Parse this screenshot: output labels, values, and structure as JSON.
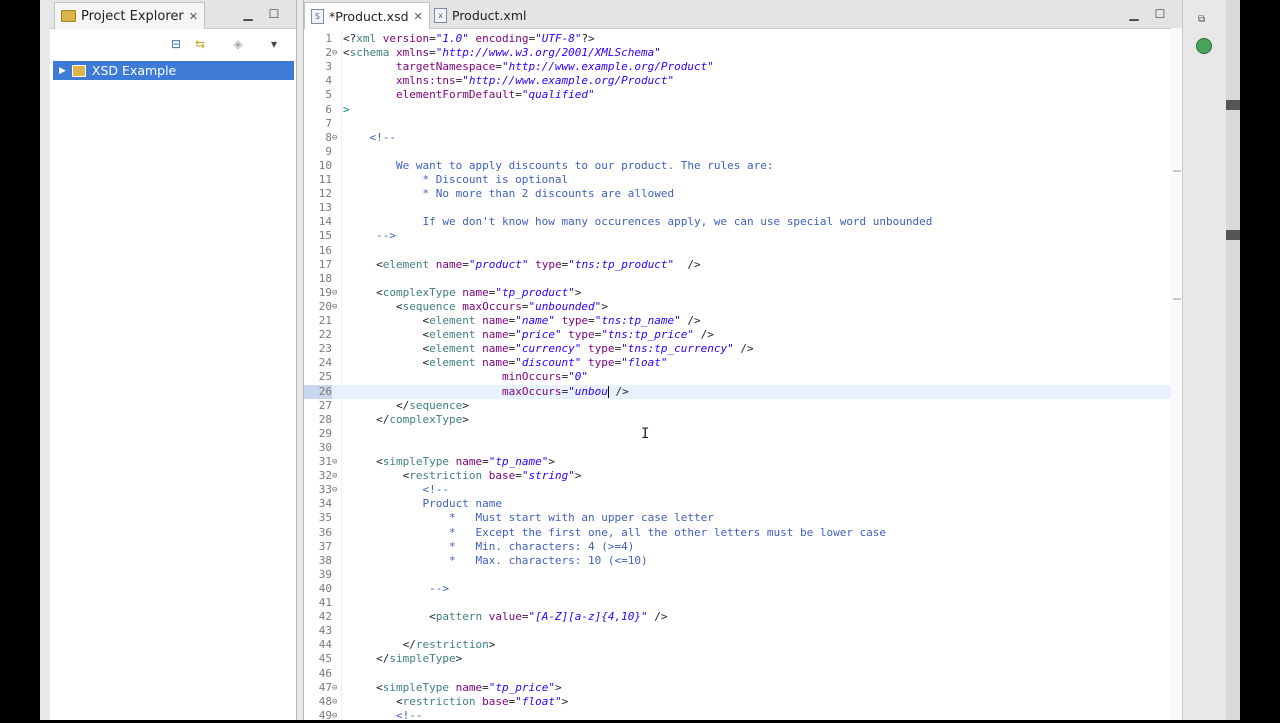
{
  "project_explorer": {
    "title": "Project Explorer",
    "tree": [
      {
        "label": "XSD Example",
        "expanded": false,
        "selected": true
      }
    ]
  },
  "editor": {
    "tabs": [
      {
        "label": "*Product.xsd",
        "active": true,
        "icon": "S"
      },
      {
        "label": "Product.xml",
        "active": false,
        "icon": "x"
      }
    ],
    "current_line": 26,
    "lines": [
      {
        "n": "1",
        "parts": [
          [
            "p",
            "<?"
          ],
          [
            "t",
            "xml "
          ],
          [
            "a",
            "version"
          ],
          [
            "p",
            "="
          ],
          [
            "v",
            "\"1.0\""
          ],
          [
            "a",
            " encoding"
          ],
          [
            "p",
            "="
          ],
          [
            "v",
            "\"UTF-8\""
          ],
          [
            "p",
            "?>"
          ]
        ]
      },
      {
        "n": "2",
        "fold": true,
        "parts": [
          [
            "p",
            "<"
          ],
          [
            "t",
            "schema "
          ],
          [
            "a",
            "xmlns"
          ],
          [
            "p",
            "="
          ],
          [
            "v",
            "\"http://www.w3.org/2001/XMLSchema\""
          ]
        ]
      },
      {
        "n": "3",
        "parts": [
          [
            "p",
            "        "
          ],
          [
            "a",
            "targetNamespace"
          ],
          [
            "p",
            "="
          ],
          [
            "v",
            "\"http://www.example.org/Product\""
          ]
        ]
      },
      {
        "n": "4",
        "parts": [
          [
            "p",
            "        "
          ],
          [
            "a",
            "xmlns:tns"
          ],
          [
            "p",
            "="
          ],
          [
            "v",
            "\"http://www.example.org/Product\""
          ]
        ]
      },
      {
        "n": "5",
        "parts": [
          [
            "p",
            "        "
          ],
          [
            "a",
            "elementFormDefault"
          ],
          [
            "p",
            "="
          ],
          [
            "v",
            "\"qualified\""
          ]
        ]
      },
      {
        "n": "6",
        "parts": [
          [
            "k",
            ">"
          ]
        ]
      },
      {
        "n": "7",
        "parts": []
      },
      {
        "n": "8",
        "fold": true,
        "parts": [
          [
            "c",
            "    <!--"
          ]
        ]
      },
      {
        "n": "9",
        "parts": []
      },
      {
        "n": "10",
        "parts": [
          [
            "c",
            "        We want to apply discounts to our product. The rules are:"
          ]
        ]
      },
      {
        "n": "11",
        "parts": [
          [
            "c",
            "            * Discount is optional"
          ]
        ]
      },
      {
        "n": "12",
        "parts": [
          [
            "c",
            "            * No more than 2 discounts are allowed"
          ]
        ]
      },
      {
        "n": "13",
        "parts": []
      },
      {
        "n": "14",
        "parts": [
          [
            "c",
            "            If we don't know how many occurences apply, we can use special word unbounded"
          ]
        ]
      },
      {
        "n": "15",
        "parts": [
          [
            "c",
            "     -->"
          ]
        ]
      },
      {
        "n": "16",
        "parts": []
      },
      {
        "n": "17",
        "parts": [
          [
            "p",
            "     <"
          ],
          [
            "t",
            "element "
          ],
          [
            "a",
            "name"
          ],
          [
            "p",
            "="
          ],
          [
            "v",
            "\"product\""
          ],
          [
            "a",
            " type"
          ],
          [
            "p",
            "="
          ],
          [
            "v",
            "\"tns:tp_product\""
          ],
          [
            "p",
            "  />"
          ]
        ]
      },
      {
        "n": "18",
        "parts": []
      },
      {
        "n": "19",
        "fold": true,
        "parts": [
          [
            "p",
            "     <"
          ],
          [
            "t",
            "complexType "
          ],
          [
            "a",
            "name"
          ],
          [
            "p",
            "="
          ],
          [
            "v",
            "\"tp_product\""
          ],
          [
            "p",
            ">"
          ]
        ]
      },
      {
        "n": "20",
        "fold": true,
        "parts": [
          [
            "p",
            "        <"
          ],
          [
            "t",
            "sequence "
          ],
          [
            "a",
            "maxOccurs"
          ],
          [
            "p",
            "="
          ],
          [
            "v",
            "\"unbounded\""
          ],
          [
            "p",
            ">"
          ]
        ]
      },
      {
        "n": "21",
        "parts": [
          [
            "p",
            "            <"
          ],
          [
            "t",
            "element "
          ],
          [
            "a",
            "name"
          ],
          [
            "p",
            "="
          ],
          [
            "v",
            "\"name\""
          ],
          [
            "a",
            " type"
          ],
          [
            "p",
            "="
          ],
          [
            "v",
            "\"tns:tp_name\""
          ],
          [
            "p",
            " />"
          ]
        ]
      },
      {
        "n": "22",
        "parts": [
          [
            "p",
            "            <"
          ],
          [
            "t",
            "element "
          ],
          [
            "a",
            "name"
          ],
          [
            "p",
            "="
          ],
          [
            "v",
            "\"price\""
          ],
          [
            "a",
            " type"
          ],
          [
            "p",
            "="
          ],
          [
            "v",
            "\"tns:tp_price\""
          ],
          [
            "p",
            " />"
          ]
        ]
      },
      {
        "n": "23",
        "parts": [
          [
            "p",
            "            <"
          ],
          [
            "t",
            "element "
          ],
          [
            "a",
            "name"
          ],
          [
            "p",
            "="
          ],
          [
            "v",
            "\"currency\""
          ],
          [
            "a",
            " type"
          ],
          [
            "p",
            "="
          ],
          [
            "v",
            "\"tns:tp_currency\""
          ],
          [
            "p",
            " />"
          ]
        ]
      },
      {
        "n": "24",
        "parts": [
          [
            "p",
            "            <"
          ],
          [
            "t",
            "element "
          ],
          [
            "a",
            "name"
          ],
          [
            "p",
            "="
          ],
          [
            "v",
            "\"discount\""
          ],
          [
            "a",
            " type"
          ],
          [
            "p",
            "="
          ],
          [
            "v",
            "\"float\""
          ]
        ]
      },
      {
        "n": "25",
        "parts": [
          [
            "p",
            "                        "
          ],
          [
            "a",
            "minOccurs"
          ],
          [
            "p",
            "="
          ],
          [
            "v",
            "\"0\""
          ]
        ]
      },
      {
        "n": "26",
        "current": true,
        "parts": [
          [
            "p",
            "                        "
          ],
          [
            "a",
            "maxOccurs"
          ],
          [
            "p",
            "="
          ],
          [
            "v",
            "\"unbou"
          ],
          [
            "caret",
            ""
          ],
          [
            "p",
            " />"
          ]
        ]
      },
      {
        "n": "27",
        "parts": [
          [
            "p",
            "        </"
          ],
          [
            "t",
            "sequence"
          ],
          [
            "p",
            ">"
          ]
        ]
      },
      {
        "n": "28",
        "parts": [
          [
            "p",
            "     </"
          ],
          [
            "t",
            "complexType"
          ],
          [
            "p",
            ">"
          ]
        ]
      },
      {
        "n": "29",
        "parts": []
      },
      {
        "n": "30",
        "parts": []
      },
      {
        "n": "31",
        "fold": true,
        "parts": [
          [
            "p",
            "     <"
          ],
          [
            "t",
            "simpleType "
          ],
          [
            "a",
            "name"
          ],
          [
            "p",
            "="
          ],
          [
            "v",
            "\"tp_name\""
          ],
          [
            "p",
            ">"
          ]
        ]
      },
      {
        "n": "32",
        "fold": true,
        "parts": [
          [
            "p",
            "         <"
          ],
          [
            "t",
            "restriction "
          ],
          [
            "a",
            "base"
          ],
          [
            "p",
            "="
          ],
          [
            "v",
            "\"string\""
          ],
          [
            "p",
            ">"
          ]
        ]
      },
      {
        "n": "33",
        "fold": true,
        "parts": [
          [
            "c",
            "            <!--"
          ]
        ]
      },
      {
        "n": "34",
        "parts": [
          [
            "c",
            "            Product name"
          ]
        ]
      },
      {
        "n": "35",
        "parts": [
          [
            "c",
            "                *   Must start with an upper case letter"
          ]
        ]
      },
      {
        "n": "36",
        "parts": [
          [
            "c",
            "                *   Except the first one, all the other letters must be lower case"
          ]
        ]
      },
      {
        "n": "37",
        "parts": [
          [
            "c",
            "                *   Min. characters: 4 (>=4)"
          ]
        ]
      },
      {
        "n": "38",
        "parts": [
          [
            "c",
            "                *   Max. characters: 10 (<=10)"
          ]
        ]
      },
      {
        "n": "39",
        "parts": []
      },
      {
        "n": "40",
        "parts": [
          [
            "c",
            "             -->"
          ]
        ]
      },
      {
        "n": "41",
        "parts": []
      },
      {
        "n": "42",
        "parts": [
          [
            "p",
            "             <"
          ],
          [
            "t",
            "pattern "
          ],
          [
            "a",
            "value"
          ],
          [
            "p",
            "="
          ],
          [
            "v",
            "\"[A-Z][a-z]{4,10}\""
          ],
          [
            "p",
            " />"
          ]
        ]
      },
      {
        "n": "43",
        "parts": []
      },
      {
        "n": "44",
        "parts": [
          [
            "p",
            "         </"
          ],
          [
            "t",
            "restriction"
          ],
          [
            "p",
            ">"
          ]
        ]
      },
      {
        "n": "45",
        "parts": [
          [
            "p",
            "     </"
          ],
          [
            "t",
            "simpleType"
          ],
          [
            "p",
            ">"
          ]
        ]
      },
      {
        "n": "46",
        "parts": []
      },
      {
        "n": "47",
        "fold": true,
        "parts": [
          [
            "p",
            "     <"
          ],
          [
            "t",
            "simpleType "
          ],
          [
            "a",
            "name"
          ],
          [
            "p",
            "="
          ],
          [
            "v",
            "\"tp_price\""
          ],
          [
            "p",
            ">"
          ]
        ]
      },
      {
        "n": "48",
        "fold": true,
        "parts": [
          [
            "p",
            "        <"
          ],
          [
            "t",
            "restriction "
          ],
          [
            "a",
            "base"
          ],
          [
            "p",
            "="
          ],
          [
            "v",
            "\"float\""
          ],
          [
            "p",
            ">"
          ]
        ]
      },
      {
        "n": "49",
        "fold": true,
        "parts": [
          [
            "c",
            "        <!--"
          ]
        ]
      }
    ]
  }
}
